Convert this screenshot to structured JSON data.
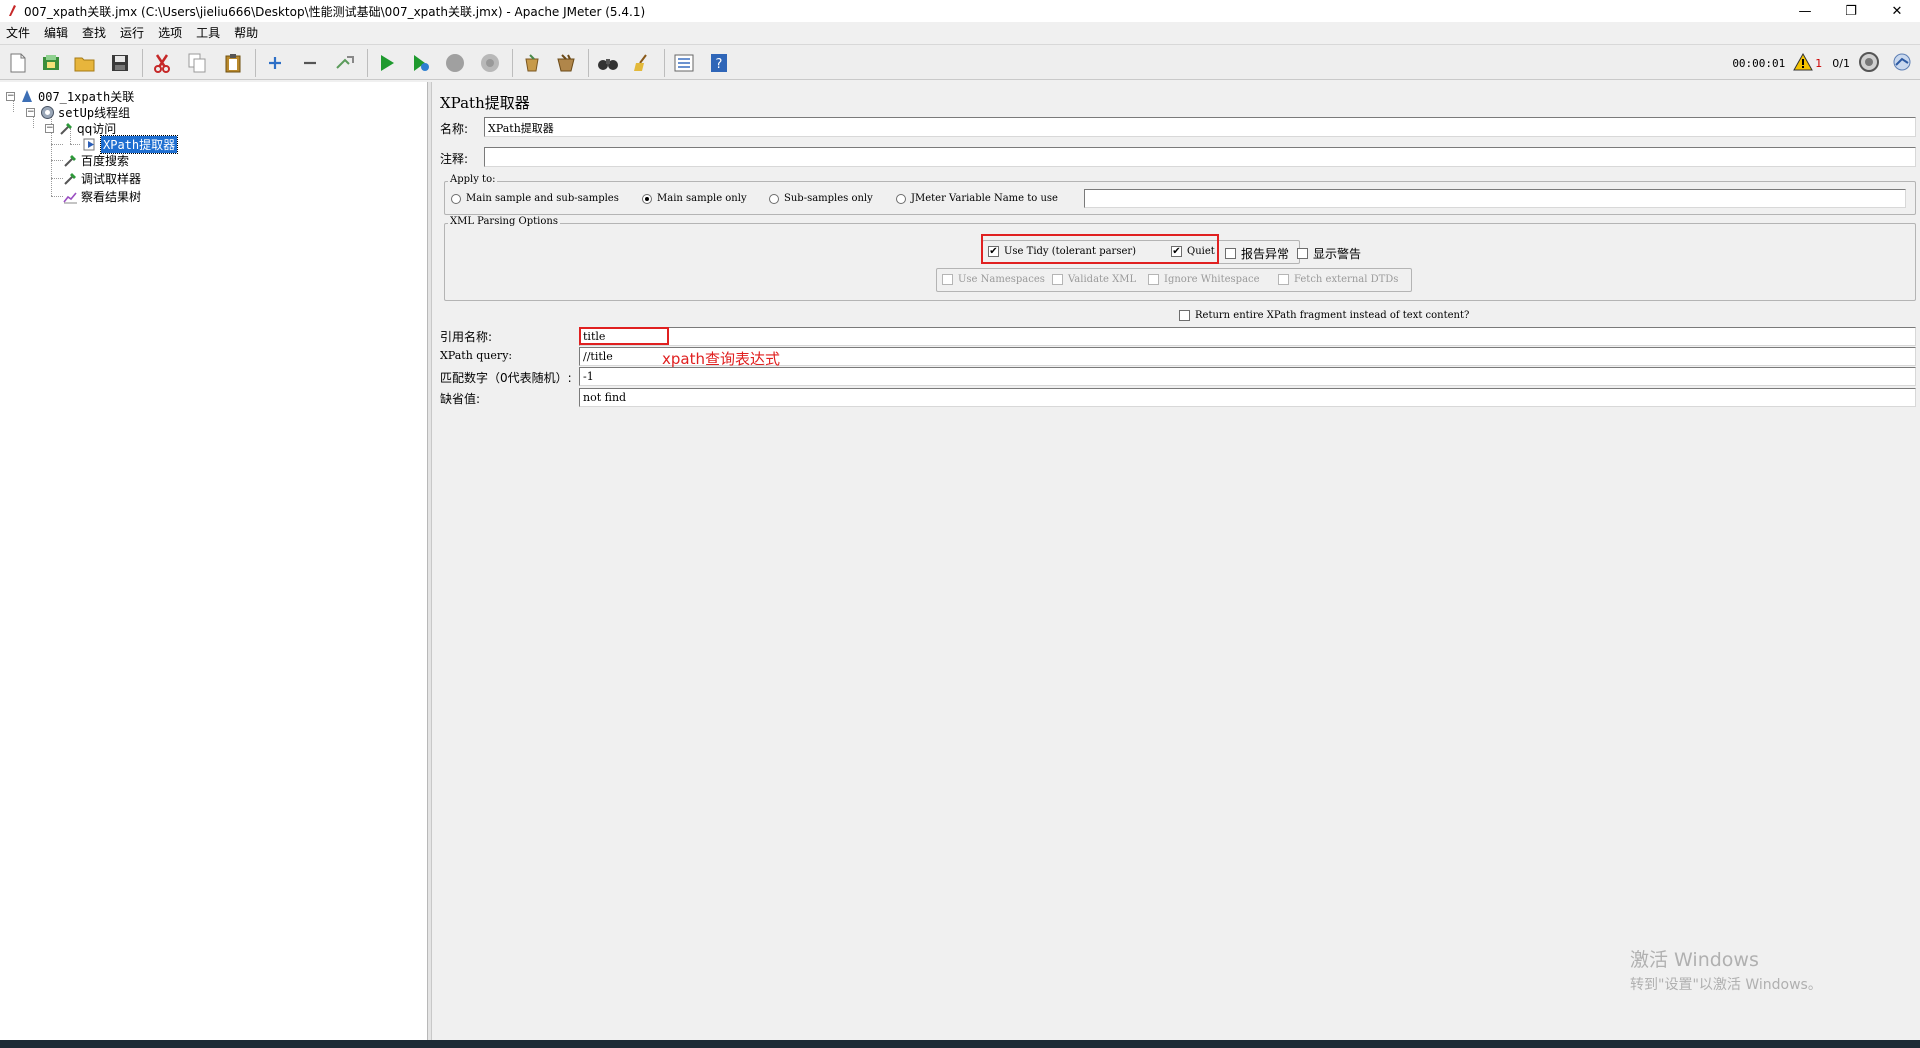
{
  "window": {
    "title": "007_xpath关联.jmx (C:\\Users\\jieliu666\\Desktop\\性能测试基础\\007_xpath关联.jmx) - Apache JMeter (5.4.1)",
    "minimize": "—",
    "maximize": "❐",
    "close": "✕"
  },
  "menu": [
    "文件",
    "编辑",
    "查找",
    "运行",
    "选项",
    "工具",
    "帮助"
  ],
  "toolbar_status": {
    "timer": "00:00:01",
    "warning_count": "1",
    "threads": "0/1"
  },
  "tree": {
    "root": "007_1xpath关联",
    "setup_group": "setUp线程组",
    "sampler_qq": "qq访问",
    "xpath_extractor": "XPath提取器",
    "sampler_baidu": "百度搜索",
    "debug_sampler": "调试取样器",
    "result_tree": "察看结果树"
  },
  "panel": {
    "heading": "XPath提取器",
    "name_label": "名称:",
    "name_value": "XPath提取器",
    "comment_label": "注释:",
    "comment_value": "",
    "apply_to": {
      "title": "Apply to:",
      "options": [
        "Main sample and sub-samples",
        "Main sample only",
        "Sub-samples only",
        "JMeter Variable Name to use"
      ],
      "selected": "Main sample only",
      "variable_value": ""
    },
    "xml_parsing": {
      "title": "XML Parsing Options",
      "use_tidy": "Use Tidy (tolerant parser)",
      "quiet": "Quiet",
      "report_errors": "报告异常",
      "show_warnings": "显示警告",
      "use_namespaces": "Use Namespaces",
      "validate_xml": "Validate XML",
      "ignore_whitespace": "Ignore Whitespace",
      "fetch_dtds": "Fetch external DTDs"
    },
    "return_fragment": "Return entire XPath fragment instead of text content?",
    "ref_name_label": "引用名称:",
    "ref_name_value": "title",
    "xpath_query_label": "XPath query:",
    "xpath_query_value": "//title",
    "xpath_annotation": "xpath查询表达式",
    "match_no_label": "匹配数字（0代表随机）:",
    "match_no_value": "-1",
    "default_label": "缺省值:",
    "default_value": "not find"
  },
  "watermark": {
    "line1": "激活 Windows",
    "line2": "转到\"设置\"以激活 Windows。"
  }
}
